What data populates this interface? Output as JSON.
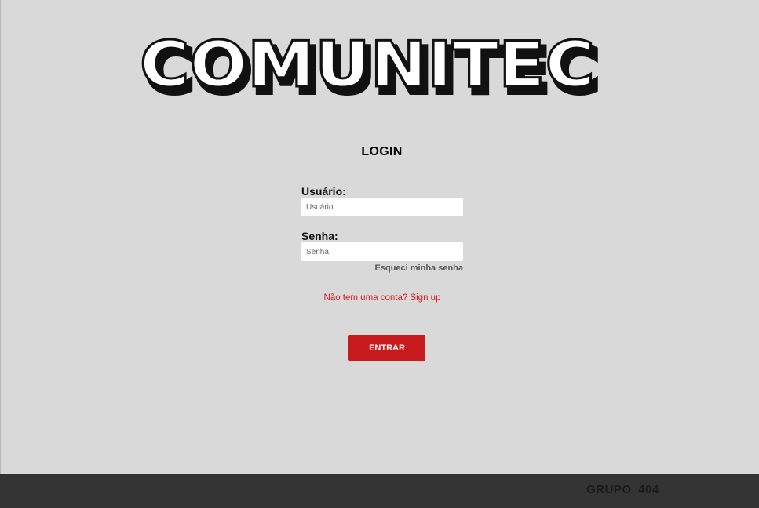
{
  "logo": {
    "text": "COMUNITEC"
  },
  "login": {
    "title": "LOGIN",
    "username_label": "Usuário:",
    "username_placeholder": "Usuário",
    "password_label": "Senha:",
    "password_placeholder": "Senha",
    "forgot_link": "Esqueci minha senha",
    "signup_link": "Não tem uma conta? Sign up",
    "submit_label": "ENTRAR"
  },
  "footer": {
    "text": "GRUPO 404"
  },
  "colors": {
    "background": "#d9d9d9",
    "accent": "#c8191c",
    "link": "#e01919",
    "footer": "#333333"
  }
}
